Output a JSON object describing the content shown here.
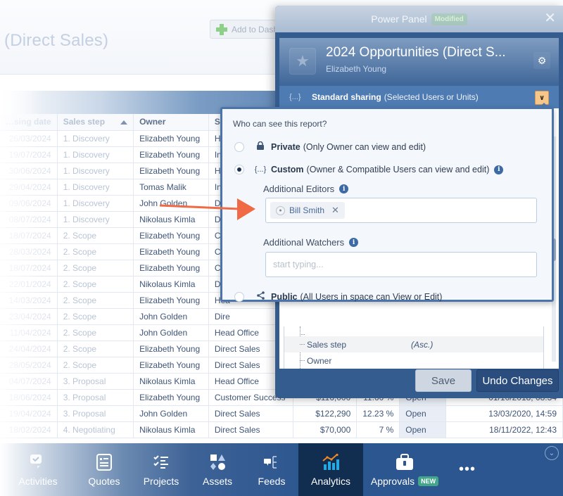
{
  "background": {
    "page_title": "(Direct Sales)",
    "add_to_dashboard_label": "Add to Dash",
    "table": {
      "headers": [
        "…sing date",
        "Sales step",
        "Owner",
        "Sal…"
      ],
      "rows": [
        {
          "date": "26/03/2024",
          "step": "1. Discovery",
          "owner": "Elizabeth Young",
          "unit": "Hea"
        },
        {
          "date": "19/07/2024",
          "step": "1. Discovery",
          "owner": "Elizabeth Young",
          "unit": "Indi"
        },
        {
          "date": "30/06/2024",
          "step": "1. Discovery",
          "owner": "Elizabeth Young",
          "unit": "Hea"
        },
        {
          "date": "29/04/2024",
          "step": "1. Discovery",
          "owner": "Tomas Malik",
          "unit": "Indi"
        },
        {
          "date": "09/06/2024",
          "step": "1. Discovery",
          "owner": "John Golden",
          "unit": "Dire"
        },
        {
          "date": "08/07/2024",
          "step": "1. Discovery",
          "owner": "Nikolaus Kimla",
          "unit": "Dire"
        },
        {
          "date": "18/07/2024",
          "step": "2. Scope",
          "owner": "Elizabeth Young",
          "unit": "Cus"
        },
        {
          "date": "28/03/2024",
          "step": "2. Scope",
          "owner": "Elizabeth Young",
          "unit": "Cus"
        },
        {
          "date": "18/07/2024",
          "step": "2. Scope",
          "owner": "Elizabeth Young",
          "unit": "Cus"
        },
        {
          "date": "22/01/2024",
          "step": "2. Scope",
          "owner": "Nikolaus Kimla",
          "unit": "Dire"
        },
        {
          "date": "14/03/2024",
          "step": "2. Scope",
          "owner": "Elizabeth Young",
          "unit": "Hea"
        },
        {
          "date": "23/04/2024",
          "step": "2. Scope",
          "owner": "John Golden",
          "unit": "Dire"
        },
        {
          "date": "11/04/2024",
          "step": "2. Scope",
          "owner": "John Golden",
          "unit": "Head Office"
        },
        {
          "date": "24/04/2024",
          "step": "2. Scope",
          "owner": "Elizabeth Young",
          "unit": "Direct Sales"
        },
        {
          "date": "28/05/2024",
          "step": "2. Scope",
          "owner": "Elizabeth Young",
          "unit": "Direct Sales"
        },
        {
          "date": "04/07/2024",
          "step": "3. Proposal",
          "owner": "Nikolaus Kimla",
          "unit": "Head Office"
        },
        {
          "date": "18/06/2024",
          "step": "3. Proposal",
          "owner": "Elizabeth Young",
          "unit": "Customer Success",
          "amount": "$116,000",
          "pct": "11.60 %",
          "status": "Open",
          "time": "01/10/2018, 08:34"
        },
        {
          "date": "19/04/2024",
          "step": "3. Proposal",
          "owner": "John Golden",
          "unit": "Direct Sales",
          "amount": "$122,290",
          "pct": "12.23 %",
          "status": "Open",
          "time": "13/03/2020, 14:59"
        },
        {
          "date": "18/02/2024",
          "step": "4. Negotiating",
          "owner": "Nikolaus Kimla",
          "unit": "Direct Sales",
          "amount": "$70,000",
          "pct": "7 %",
          "status": "Open",
          "time": "18/11/2022, 12:43"
        }
      ]
    }
  },
  "power_panel": {
    "title": "Power Panel",
    "modified_badge": "Modified",
    "report_title": "2024 Opportunities (Direct S...",
    "report_owner": "Elizabeth Young",
    "sharing_icon": "{...}",
    "sharing_mode": "Standard sharing",
    "sharing_mode_detail": "(Selected Users or Units)",
    "sort_tree": [
      {
        "label": "Sales step",
        "order": "(Asc.)"
      },
      {
        "label": "Owner",
        "order": ""
      }
    ],
    "save_label": "Save",
    "undo_label": "Undo Changes"
  },
  "sharing_popover": {
    "question": "Who can see this report?",
    "options": [
      {
        "icon": "lock-icon",
        "title": "Private",
        "detail": "(Only Owner can view and edit)",
        "selected": false
      },
      {
        "icon": "{...}",
        "title": "Custom",
        "detail": "(Owner & Compatible Users can view and edit)",
        "selected": true
      },
      {
        "icon": "share-icon",
        "title": "Public",
        "detail": "(All Users in space can View or Edit)",
        "selected": false
      }
    ],
    "editors_label": "Additional Editors",
    "editors": [
      "Bill Smith"
    ],
    "watchers_label": "Additional Watchers",
    "watchers_placeholder": "start typing..."
  },
  "bottom_nav": {
    "items": [
      {
        "label": "Activities",
        "icon": "activities-icon"
      },
      {
        "label": "Quotes",
        "icon": "quotes-icon"
      },
      {
        "label": "Projects",
        "icon": "projects-icon"
      },
      {
        "label": "Assets",
        "icon": "assets-icon"
      },
      {
        "label": "Feeds",
        "icon": "feeds-icon"
      },
      {
        "label": "Analytics",
        "icon": "analytics-icon",
        "active": true
      },
      {
        "label": "Approvals",
        "icon": "approvals-icon",
        "badge": "NEW"
      },
      {
        "label": "",
        "icon": "more-icon"
      }
    ]
  },
  "colors": {
    "accent": "#2c568f",
    "panel": "#355c8e",
    "popover_border": "#4a74aa",
    "annotation_arrow": "#ef6a45",
    "badge_new": "#43a68a",
    "dropdown_button": "#f7c68a"
  }
}
